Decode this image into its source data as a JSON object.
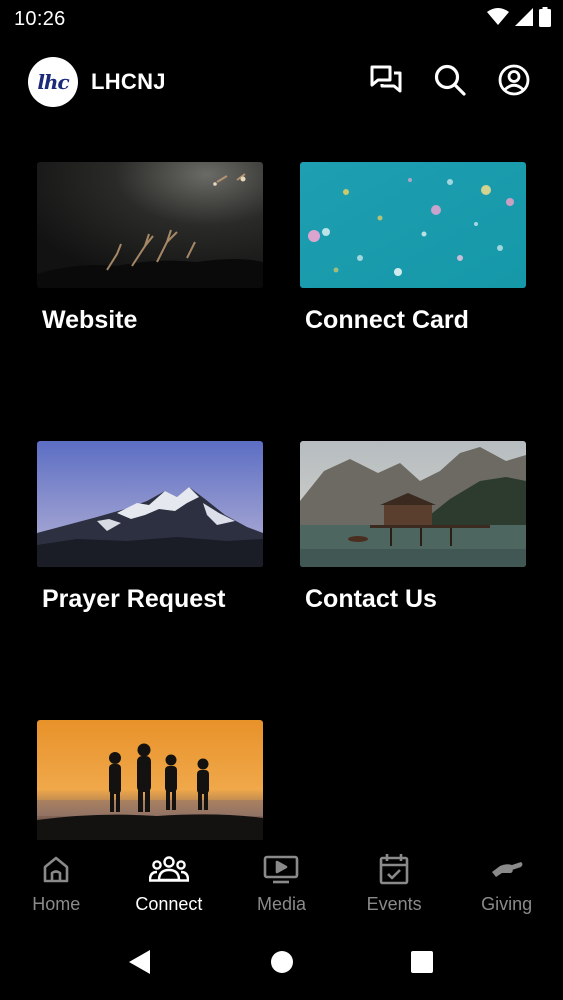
{
  "status_bar": {
    "time": "10:26"
  },
  "header": {
    "logo_text": "lhc",
    "title": "LHCNJ"
  },
  "cards": [
    {
      "label": "Website",
      "image": "concert-crowd-hands"
    },
    {
      "label": "Connect Card",
      "image": "confetti-teal"
    },
    {
      "label": "Prayer Request",
      "image": "snowy-mountain"
    },
    {
      "label": "Contact Us",
      "image": "lake-cabin-mountains"
    },
    {
      "label": "",
      "image": "family-sunset-silhouette"
    }
  ],
  "bottom_nav": [
    {
      "label": "Home",
      "icon": "home-icon",
      "active": false
    },
    {
      "label": "Connect",
      "icon": "people-icon",
      "active": true
    },
    {
      "label": "Media",
      "icon": "media-icon",
      "active": false
    },
    {
      "label": "Events",
      "icon": "calendar-icon",
      "active": false
    },
    {
      "label": "Giving",
      "icon": "giving-hand-icon",
      "active": false
    }
  ],
  "colors": {
    "background": "#000000",
    "active_nav": "#ffffff",
    "inactive_nav": "#8a8a8a",
    "logo_text": "#1c2a7a"
  }
}
